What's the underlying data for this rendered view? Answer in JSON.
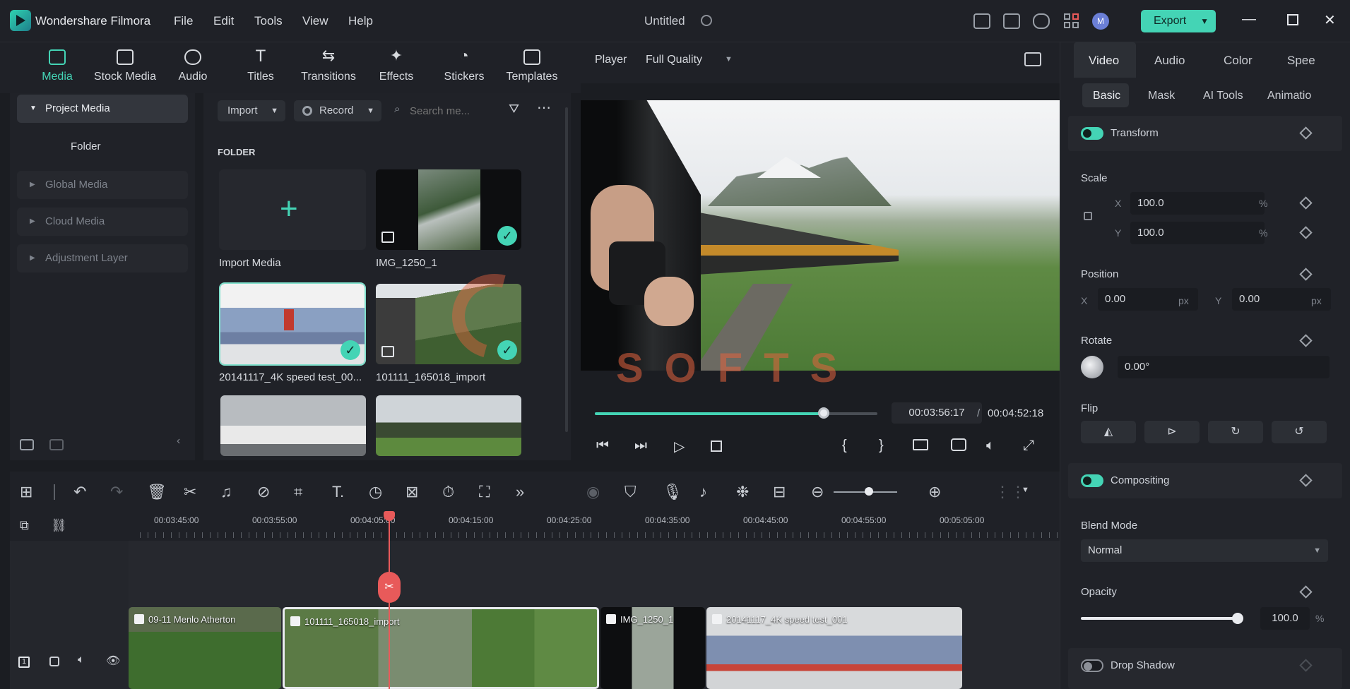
{
  "app": {
    "name": "Wondershare Filmora",
    "document_title": "Untitled",
    "menu": [
      "File",
      "Edit",
      "Tools",
      "View",
      "Help"
    ],
    "export_label": "Export",
    "avatar_initial": "M"
  },
  "media_tabs": [
    {
      "label": "Media",
      "icon": "media-icon",
      "active": true
    },
    {
      "label": "Stock Media",
      "icon": "stock-media-icon"
    },
    {
      "label": "Audio",
      "icon": "music-note-icon"
    },
    {
      "label": "Titles",
      "icon": "title-t-icon"
    },
    {
      "label": "Transitions",
      "icon": "transitions-icon"
    },
    {
      "label": "Effects",
      "icon": "effects-icon"
    },
    {
      "label": "Stickers",
      "icon": "stickers-icon"
    },
    {
      "label": "Templates",
      "icon": "templates-icon"
    }
  ],
  "library": {
    "items": [
      "Project Media",
      "Folder",
      "Global Media",
      "Cloud Media",
      "Adjustment Layer"
    ]
  },
  "media": {
    "import_label": "Import",
    "record_label": "Record",
    "search_placeholder": "Search me...",
    "folder_heading": "FOLDER",
    "items": [
      {
        "caption": "Import Media"
      },
      {
        "caption": "IMG_1250_1"
      },
      {
        "caption": "20141117_4K speed test_00..."
      },
      {
        "caption": "101111_165018_import"
      }
    ]
  },
  "player": {
    "label": "Player",
    "quality": "Full Quality",
    "current_time": "00:03:56:17",
    "separator": "/",
    "total_time": "00:04:52:18",
    "progress": 0.81,
    "watermark": "SOFTS"
  },
  "right_panel": {
    "tabs": [
      "Video",
      "Audio",
      "Color",
      "Spee"
    ],
    "subtabs": [
      "Basic",
      "Mask",
      "AI Tools",
      "Animatio"
    ],
    "transform": {
      "title": "Transform",
      "scale_label": "Scale",
      "x_label": "X",
      "y_label": "Y",
      "scale_x": "100.0",
      "scale_y": "100.0",
      "percent": "%",
      "position_label": "Position",
      "pos_x": "0.00",
      "pos_y": "0.00",
      "px": "px",
      "rotate_label": "Rotate",
      "rotate_value": "0.00°",
      "flip_label": "Flip"
    },
    "compositing": {
      "title": "Compositing",
      "blend_label": "Blend Mode",
      "blend_value": "Normal",
      "opacity_label": "Opacity",
      "opacity_value": "100.0",
      "opacity_unit": "%",
      "opacity_level": 1.0
    },
    "drop_shadow": {
      "title": "Drop Shadow"
    }
  },
  "timeline": {
    "ticks": [
      "00:03:45:00",
      "00:03:55:00",
      "00:04:05:00",
      "00:04:15:00",
      "00:04:25:00",
      "00:04:35:00",
      "00:04:45:00",
      "00:04:55:00",
      "00:05:05:00"
    ],
    "clips": [
      {
        "name": "09-11 Menlo Atherton"
      },
      {
        "name": "101111_165018_import"
      },
      {
        "name": "IMG_1250_1"
      },
      {
        "name": "20141117_4K speed test_001"
      }
    ],
    "track_number": "1"
  },
  "colors": {
    "accent": "#44d4b5",
    "playhead": "#e85a5a",
    "background": "#1b1d22"
  }
}
